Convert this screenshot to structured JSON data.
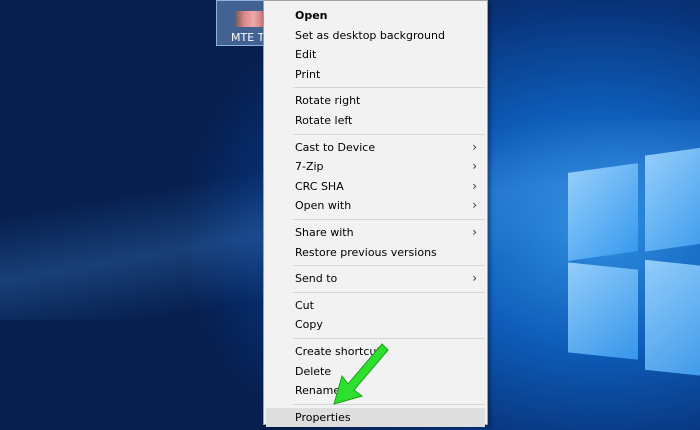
{
  "desktop": {
    "icon_label": "MTE T..."
  },
  "menu": {
    "groups": [
      [
        {
          "label": "Open",
          "bold": true
        },
        {
          "label": "Set as desktop background"
        },
        {
          "label": "Edit"
        },
        {
          "label": "Print"
        }
      ],
      [
        {
          "label": "Rotate right"
        },
        {
          "label": "Rotate left"
        }
      ],
      [
        {
          "label": "Cast to Device",
          "submenu": true
        },
        {
          "label": "7-Zip",
          "submenu": true
        },
        {
          "label": "CRC SHA",
          "submenu": true
        },
        {
          "label": "Open with",
          "submenu": true
        }
      ],
      [
        {
          "label": "Share with",
          "submenu": true
        },
        {
          "label": "Restore previous versions"
        }
      ],
      [
        {
          "label": "Send to",
          "submenu": true
        }
      ],
      [
        {
          "label": "Cut"
        },
        {
          "label": "Copy"
        }
      ],
      [
        {
          "label": "Create shortcut"
        },
        {
          "label": "Delete"
        },
        {
          "label": "Rename"
        }
      ],
      [
        {
          "label": "Properties",
          "highlighted": true
        }
      ]
    ]
  },
  "colors": {
    "arrow": "#2ee02e",
    "highlight": "#dedede"
  }
}
